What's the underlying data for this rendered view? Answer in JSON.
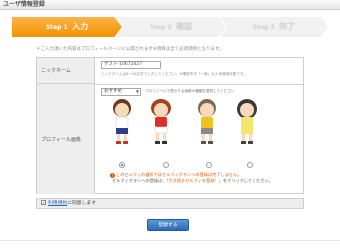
{
  "window": {
    "title": "ユーザ情報登録"
  },
  "steps": [
    {
      "num": "Step 1",
      "label": "入力",
      "active": true
    },
    {
      "num": "Step 2",
      "label": "確認",
      "active": false
    },
    {
      "num": "Step 3",
      "label": "完了",
      "active": false
    }
  ],
  "note": "＊ご入力頂いた内容はプロフィールページに公開されます※項目は全て必須項目となります。",
  "form": {
    "nickname_label": "ニックネーム",
    "nickname_value": "ゲスト-10672427",
    "nickname_help": "ニックネームは6〜16文字で入力してください。※確認不可「一部」カナ米使用可能です。",
    "profile_label": "プロフィール画像",
    "select_value": "おすすめ",
    "select_help": "プロフィールで表示する画像の種類を選択してください",
    "avatars": [
      {
        "name": "boy-brown",
        "selected": true
      },
      {
        "name": "girl-red",
        "selected": false
      },
      {
        "name": "boy-yellow",
        "selected": false
      },
      {
        "name": "girl-dark",
        "selected": false
      }
    ],
    "warning_1": "このセルフィの選択ではセルフィグランへの登録は完了しません。",
    "warning_2_pre": "セルフィグランへの登録は、「",
    "warning_2_em": "引き続きセルフィを登録！",
    "warning_2_post": "」をクリックしてください。"
  },
  "agree": {
    "link": "利用規約",
    "text": "に同意します"
  },
  "submit": {
    "label": "登録する"
  },
  "colors": {
    "accent": "#f39200",
    "button": "#2c6ab5",
    "warning": "#e05a00"
  }
}
